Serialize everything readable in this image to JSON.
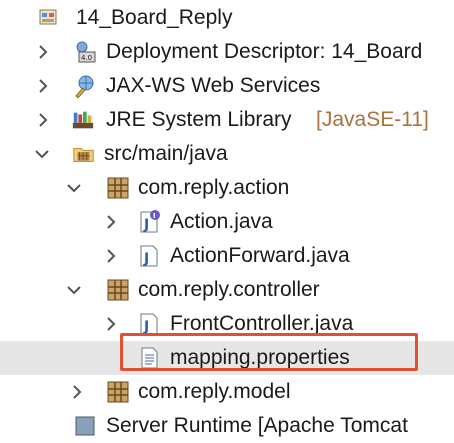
{
  "tree": {
    "project": {
      "label": "14_Board_Reply"
    },
    "deployment_descriptor": {
      "label": "Deployment Descriptor: 14_Board"
    },
    "jaxws": {
      "label": "JAX-WS Web Services"
    },
    "jre": {
      "label": "JRE System Library",
      "decoration": "[JavaSE-11]"
    },
    "src": {
      "label": "src/main/java"
    },
    "pkg_action": {
      "label": "com.reply.action"
    },
    "action_java": {
      "label": "Action.java"
    },
    "actionforward_java": {
      "label": "ActionForward.java"
    },
    "pkg_controller": {
      "label": "com.reply.controller"
    },
    "frontcontroller_java": {
      "label": "FrontController.java"
    },
    "mapping_properties": {
      "label": "mapping.properties"
    },
    "pkg_model": {
      "label": "com.reply.model"
    },
    "partial_row": {
      "label": "Server Runtime [Apache Tomcat"
    }
  },
  "colors": {
    "highlight": "#e2512f",
    "selection": "#e6e6e6",
    "decoration": "#a8743b"
  }
}
